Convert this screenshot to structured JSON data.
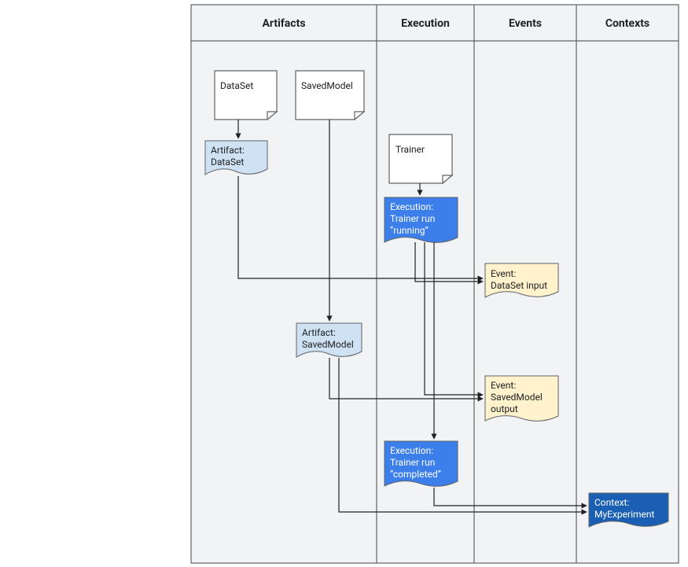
{
  "columns": {
    "artifacts": "Artifacts",
    "execution": "Execution",
    "events": "Events",
    "contexts": "Contexts"
  },
  "docs": {
    "dataset": "DataSet",
    "savedmodel": "SavedModel",
    "trainer": "Trainer"
  },
  "notes": {
    "artifact_dataset_l1": "Artifact:",
    "artifact_dataset_l2": "DataSet",
    "artifact_savedmodel_l1": "Artifact:",
    "artifact_savedmodel_l2": "SavedModel",
    "exec_running_l1": "Execution:",
    "exec_running_l2": "Trainer run",
    "exec_running_l3": "“running”",
    "exec_completed_l1": "Execution:",
    "exec_completed_l2": "Trainer run",
    "exec_completed_l3": "“completed”",
    "event_ds_l1": "Event:",
    "event_ds_l2": "DataSet input",
    "event_sm_l1": "Event:",
    "event_sm_l2": "SavedModel",
    "event_sm_l3": "output",
    "context_l1": "Context:",
    "context_l2": "MyExperiment"
  }
}
